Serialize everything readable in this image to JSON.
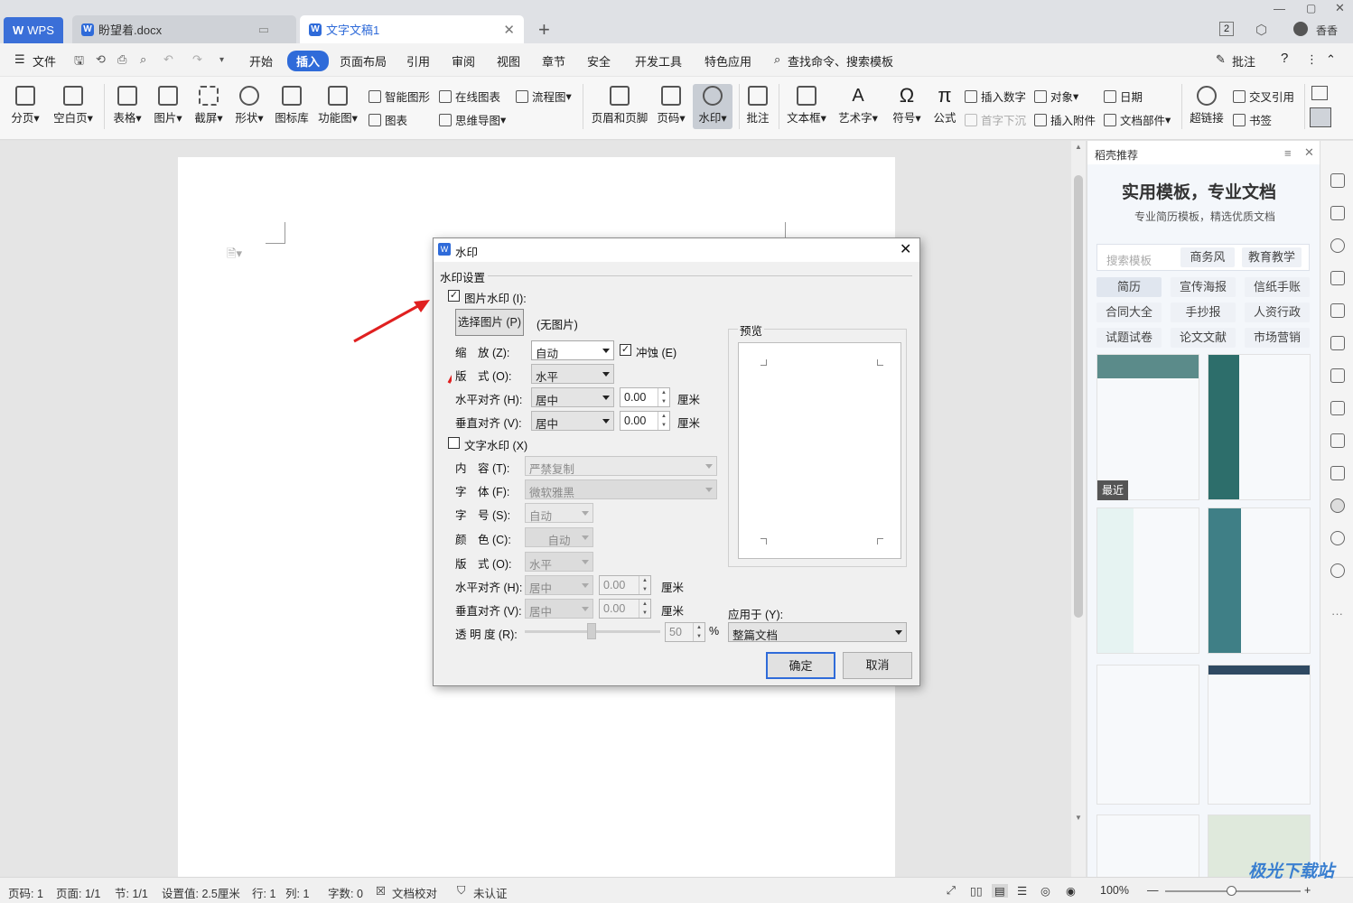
{
  "titlebar": {
    "app_tab": "WPS",
    "doc_tab1": "盼望着.docx",
    "doc_tab2": "文字文稿1",
    "add_tab": "+",
    "badge": "2",
    "user": "香香"
  },
  "menubar": {
    "file": "文件",
    "items": [
      "开始",
      "插入",
      "页面布局",
      "引用",
      "审阅",
      "视图",
      "章节",
      "安全",
      "开发工具",
      "特色应用"
    ],
    "search": "查找命令、搜索模板",
    "comment": "批注",
    "help": "?"
  },
  "toolbar": {
    "pagebreak": "分页",
    "blank": "空白页",
    "table": "表格",
    "picture": "图片",
    "screenshot": "截屏",
    "shape": "形状",
    "iconlib": "图标库",
    "funcmap": "功能图",
    "smart": "智能图形",
    "online_chart": "在线图表",
    "flowchart": "流程图",
    "chart": "图表",
    "mindmap": "思维导图",
    "header_footer": "页眉和页脚",
    "pagenum": "页码",
    "watermark": "水印",
    "comment": "批注",
    "textbox": "文本框",
    "wordart": "艺术字",
    "symbol": "符号",
    "formula": "公式",
    "insert_number": "插入数字",
    "object": "对象",
    "date": "日期",
    "dropcap": "首字下沉",
    "attachment": "插入附件",
    "docparts": "文档部件",
    "hyperlink": "超链接",
    "crossref": "交叉引用",
    "bookmark": "书签"
  },
  "dialog": {
    "title": "水印",
    "section": "水印设置",
    "pic_wm": "图片水印 (I):",
    "select_pic": "选择图片 (P)",
    "no_pic": "(无图片)",
    "scale_label": "缩　放 (Z):",
    "scale_val": "自动",
    "washout": "冲蚀 (E)",
    "layout_label": "版　式 (O):",
    "layout_val": "水平",
    "halign_label": "水平对齐 (H):",
    "halign_val": "居中",
    "h_off": "0.00",
    "unit": "厘米",
    "valign_label": "垂直对齐 (V):",
    "valign_val": "居中",
    "v_off": "0.00",
    "text_wm": "文字水印 (X)",
    "content_label": "内　容 (T):",
    "content_val": "严禁复制",
    "font_label": "字　体 (F):",
    "font_val": "微软雅黑",
    "size_label": "字　号 (S):",
    "size_val": "自动",
    "color_label": "颜　色 (C):",
    "color_val": "自动",
    "tlayout_label": "版　式 (O):",
    "tlayout_val": "水平",
    "th_label": "水平对齐 (H):",
    "th_val": "居中",
    "th_off": "0.00",
    "tv_label": "垂直对齐 (V):",
    "tv_val": "居中",
    "tv_off": "0.00",
    "trans_label": "透 明 度 (R):",
    "trans_val": "50",
    "percent": "%",
    "preview": "预览",
    "apply_label": "应用于 (Y):",
    "apply_val": "整篇文档",
    "ok": "确定",
    "cancel": "取消"
  },
  "sidepanel": {
    "header": "稻壳推荐",
    "headline": "实用模板，专业文档",
    "sub": "专业简历模板，精选优质文档",
    "search_ph": "搜索模板",
    "tag1": "商务风",
    "tag2": "教育教学",
    "tags": [
      "简历",
      "宣传海报",
      "信纸手账",
      "合同大全",
      "手抄报",
      "人资行政",
      "试题试卷",
      "论文文献",
      "市场营销"
    ],
    "recent": "最近"
  },
  "statusbar": {
    "page": "页码: 1",
    "pages": "页面: 1/1",
    "section": "节: 1/1",
    "setting": "设置值: 2.5厘米",
    "row": "行: 1",
    "col": "列: 1",
    "words": "字数: 0",
    "proof": "文档校对",
    "cert": "未认证",
    "zoom": "100%"
  },
  "watermark_text": "极光下载站"
}
